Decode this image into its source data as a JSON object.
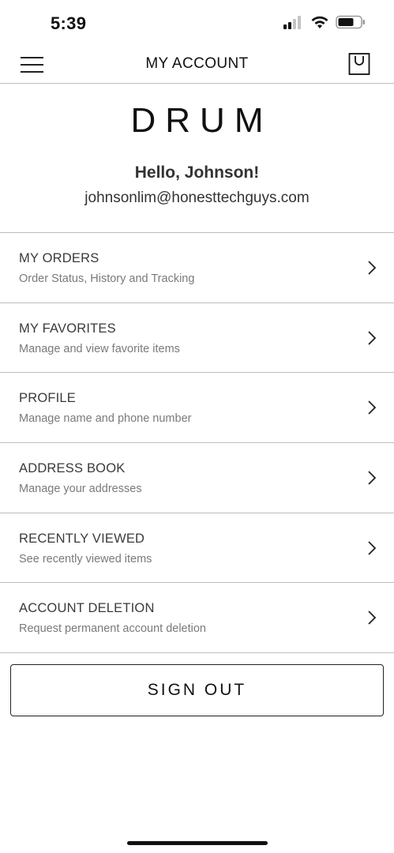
{
  "status_bar": {
    "time": "5:39",
    "icons": [
      "cellular-signal-icon",
      "wifi-icon",
      "battery-icon"
    ]
  },
  "header": {
    "title": "MY ACCOUNT",
    "menu_icon": "hamburger-menu-icon",
    "bag_icon": "shopping-bag-icon"
  },
  "profile": {
    "brand": "DRUM",
    "greeting": "Hello, Johnson!",
    "email": "johnsonlim@honesttechguys.com"
  },
  "menu": {
    "items": [
      {
        "title": "MY ORDERS",
        "subtitle": "Order Status, History and Tracking"
      },
      {
        "title": "MY FAVORITES",
        "subtitle": "Manage and view favorite items"
      },
      {
        "title": "PROFILE",
        "subtitle": "Manage name and phone number"
      },
      {
        "title": "ADDRESS BOOK",
        "subtitle": "Manage your addresses"
      },
      {
        "title": "RECENTLY VIEWED",
        "subtitle": "See recently viewed items"
      },
      {
        "title": "ACCOUNT DELETION",
        "subtitle": "Request permanent account deletion"
      }
    ]
  },
  "actions": {
    "sign_out_label": "SIGN OUT"
  },
  "colors": {
    "text_primary": "#111111",
    "text_secondary": "#7a7a7a",
    "divider": "#bdbdbd",
    "background": "#ffffff"
  }
}
